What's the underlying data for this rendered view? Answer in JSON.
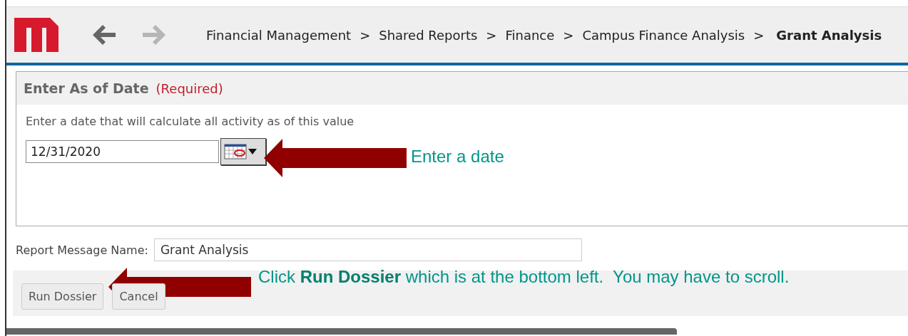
{
  "header": {
    "nav": [
      {
        "kind": "back",
        "disabled": false
      },
      {
        "kind": "forward",
        "disabled": true
      }
    ],
    "breadcrumbs": [
      {
        "kind": "link",
        "label": "Financial Management"
      },
      {
        "kind": "separator",
        "label": ">"
      },
      {
        "kind": "link",
        "label": "Shared Reports"
      },
      {
        "kind": "separator",
        "label": ">"
      },
      {
        "kind": "link",
        "label": "Finance"
      },
      {
        "kind": "separator",
        "label": ">"
      },
      {
        "kind": "link",
        "label": "Campus Finance Analysis"
      },
      {
        "kind": "separator",
        "label": ">"
      },
      {
        "kind": "current",
        "label": "Grant Analysis"
      }
    ]
  },
  "prompt": {
    "title": "Enter As of Date",
    "required": "(Required)",
    "description": "Enter a date that will calculate all activity as of this value",
    "date_value": "12/31/2020"
  },
  "report_message": {
    "label": "Report Message Name:",
    "value": "Grant Analysis"
  },
  "buttons": [
    "Run Dossier",
    "Cancel"
  ],
  "annotations": [
    {
      "text": "Enter a date"
    },
    {
      "text": "Click **Run Dossier** which is at the bottom left.  You may have to scroll."
    }
  ]
}
